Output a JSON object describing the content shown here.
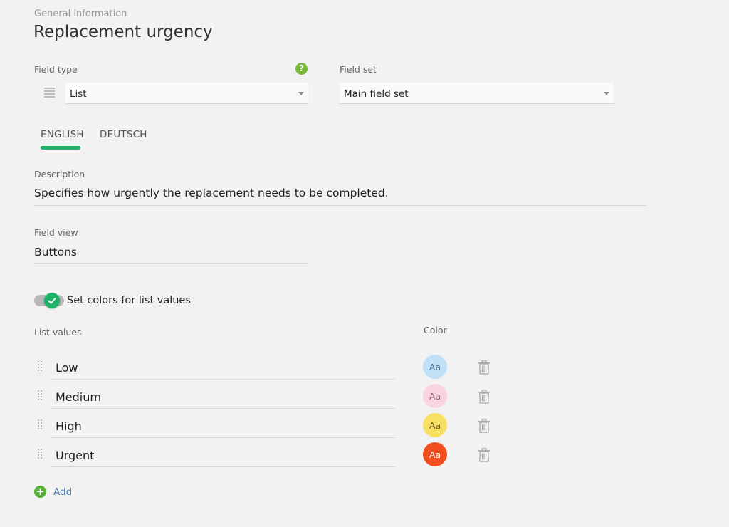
{
  "header": {
    "section_label": "General information",
    "title": "Replacement urgency"
  },
  "field_type": {
    "label": "Field type",
    "value": "List",
    "help_icon": "question-circle-icon",
    "type_icon": "list-lines-icon"
  },
  "field_set": {
    "label": "Field set",
    "value": "Main field set"
  },
  "tabs": [
    {
      "label": "ENGLISH",
      "active": true
    },
    {
      "label": "DEUTSCH",
      "active": false
    }
  ],
  "description": {
    "label": "Description",
    "value": "Specifies how urgently the replacement needs to be completed."
  },
  "field_view": {
    "label": "Field view",
    "value": "Buttons"
  },
  "colors_toggle": {
    "label": "Set colors for list values",
    "on": true
  },
  "list": {
    "label": "List values",
    "color_header": "Color",
    "swatch_text": "Aa",
    "items": [
      {
        "value": "Low",
        "color": "#bfe0f7",
        "text_color": "#4a6f8f"
      },
      {
        "value": "Medium",
        "color": "#f9d3df",
        "text_color": "#9a6575"
      },
      {
        "value": "High",
        "color": "#f8e064",
        "text_color": "#6b5d1d"
      },
      {
        "value": "Urgent",
        "color": "#f04e1f",
        "text_color": "#ffffff"
      }
    ]
  },
  "add_button": {
    "label": "Add"
  },
  "colors": {
    "accent_green": "#1fb26b",
    "link_blue": "#4a78b0",
    "background": "#f2f2f2"
  }
}
